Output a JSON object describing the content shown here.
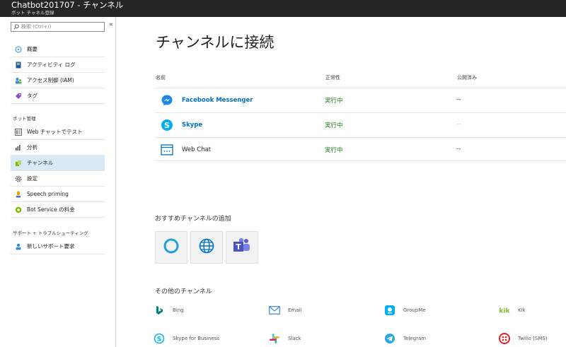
{
  "window": {
    "title": "Chatbot201707 - チャンネル",
    "subtitle": "ボット チャネル登録"
  },
  "sidebar": {
    "search_placeholder": "検索 (Ctrl+/)",
    "collapse_glyph": "«",
    "items": [
      {
        "label": "概要",
        "icon": "overview-icon"
      },
      {
        "label": "アクティビティ ログ",
        "icon": "activity-log-icon"
      },
      {
        "label": "アクセス制御 (IAM)",
        "icon": "iam-icon"
      },
      {
        "label": "タグ",
        "icon": "tag-icon"
      },
      {
        "label": "Web チャットでテスト",
        "icon": "web-chat-test-icon"
      },
      {
        "label": "分析",
        "icon": "analytics-icon"
      },
      {
        "label": "チャンネル",
        "icon": "channels-icon"
      },
      {
        "label": "設定",
        "icon": "gear-icon"
      },
      {
        "label": "Speech priming",
        "icon": "speech-priming-icon"
      },
      {
        "label": "Bot Service の料金",
        "icon": "pricing-icon"
      },
      {
        "label": "新しいサポート要求",
        "icon": "support-request-icon"
      }
    ],
    "sections": {
      "bot_management": "ボット管理",
      "support": "サポート + トラブルシューティング"
    },
    "active_index": 6
  },
  "main": {
    "title": "チャンネルに接続",
    "table": {
      "headers": [
        "名前",
        "正常性",
        "公開済み"
      ],
      "rows": [
        {
          "name": "Facebook Messenger",
          "status": "実行中",
          "published": "--",
          "icon": "facebook-messenger-icon"
        },
        {
          "name": "Skype",
          "status": "実行中",
          "published": "--",
          "icon": "skype-icon"
        },
        {
          "name": "Web Chat",
          "status": "実行中",
          "published": "--",
          "icon": "web-chat-icon"
        }
      ]
    },
    "recommended": {
      "title": "おすすめチャンネルの追加",
      "tiles": [
        {
          "icon": "cortana-icon"
        },
        {
          "icon": "direct-line-globe-icon"
        },
        {
          "icon": "microsoft-teams-icon"
        }
      ]
    },
    "others": {
      "title": "その他のチャンネル",
      "items": [
        {
          "label": "Bing",
          "icon": "bing-icon"
        },
        {
          "label": "Email",
          "icon": "email-icon"
        },
        {
          "label": "GroupMe",
          "icon": "groupme-icon"
        },
        {
          "label": "Kik",
          "icon": "kik-icon"
        },
        {
          "label": "Skype for Business",
          "icon": "skype-for-business-icon"
        },
        {
          "label": "Slack",
          "icon": "slack-icon"
        },
        {
          "label": "Telegram",
          "icon": "telegram-icon"
        },
        {
          "label": "Twilio (SMS)",
          "icon": "twilio-icon"
        }
      ]
    }
  },
  "colors": {
    "titlebar_bg": "#252526",
    "link": "#0072c6",
    "status_ok": "#1a7f1a",
    "active_nav": "#d8e9f7"
  }
}
